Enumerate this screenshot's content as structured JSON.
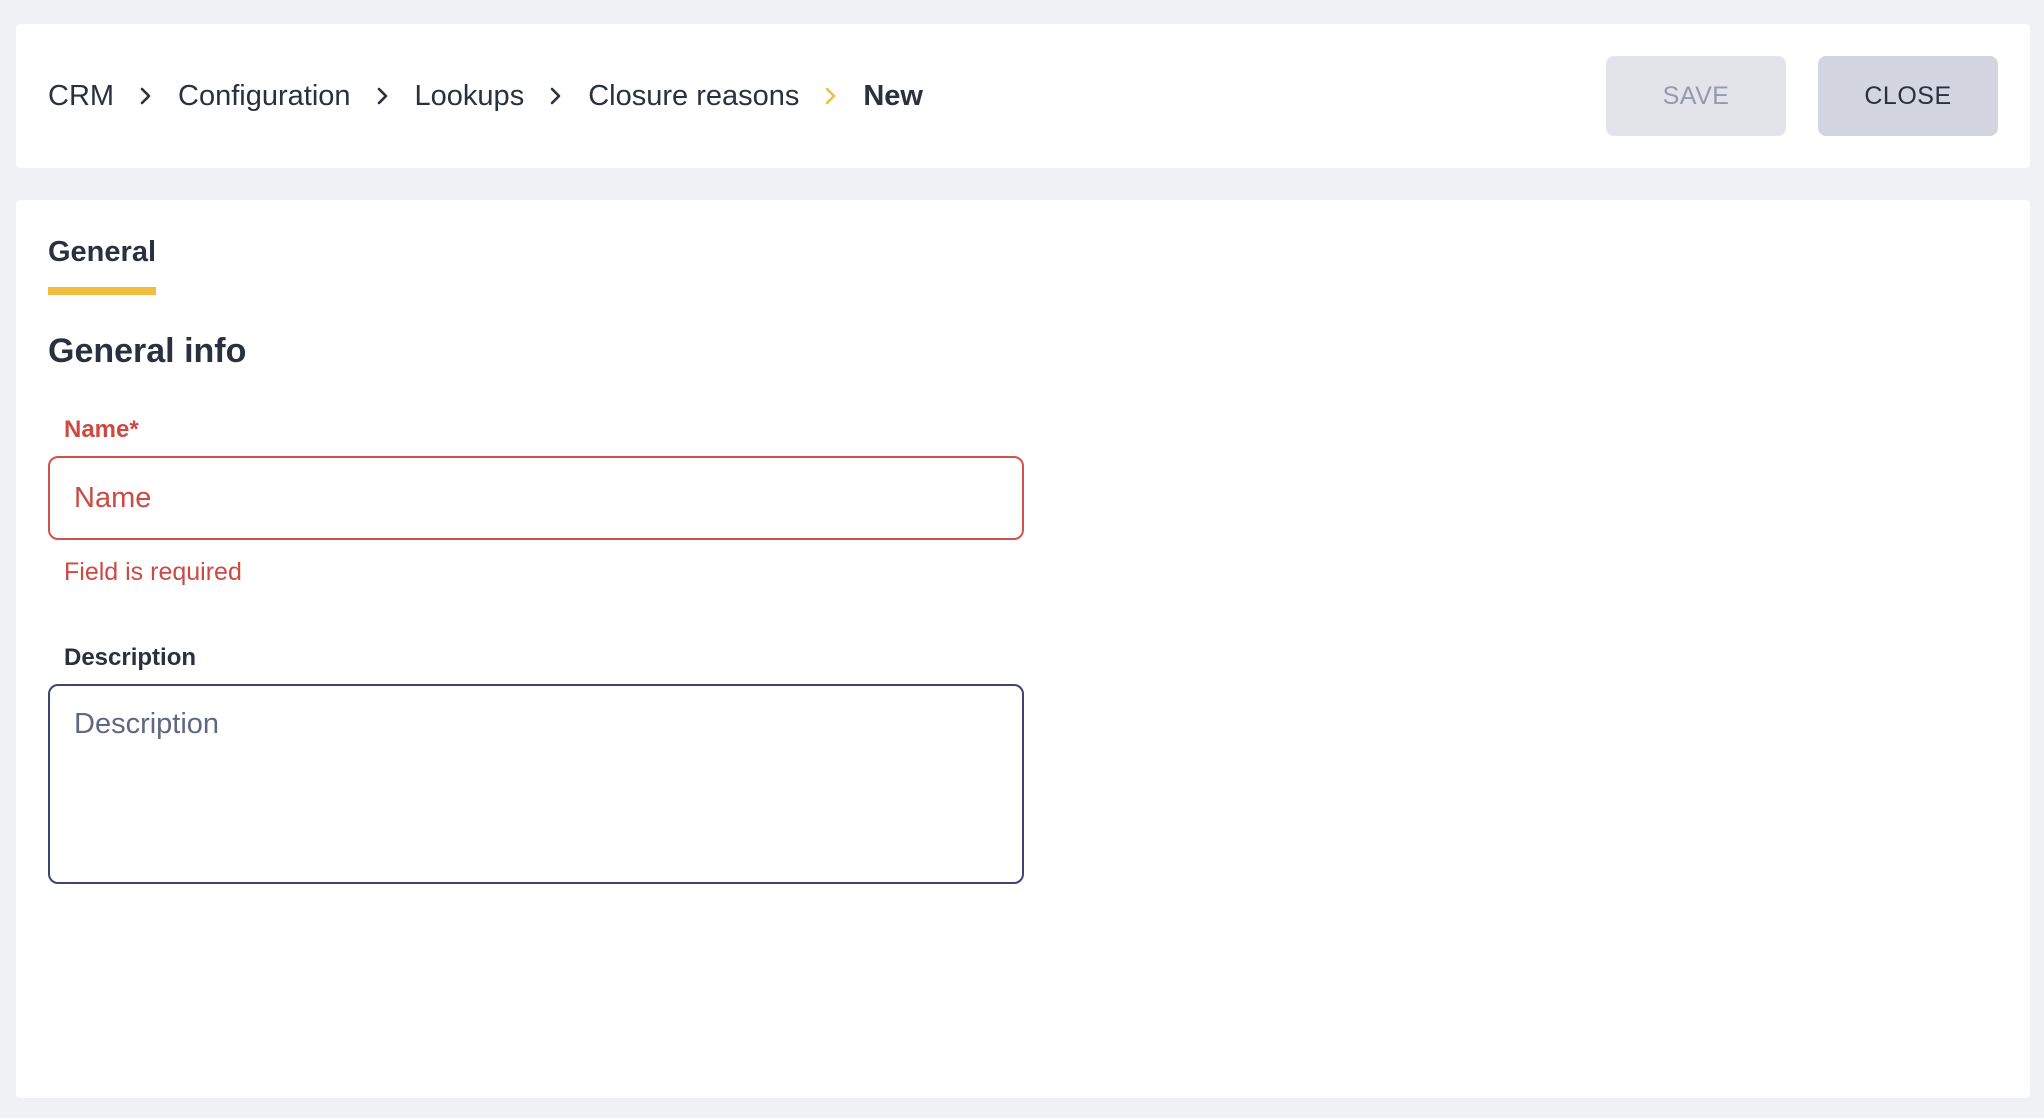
{
  "breadcrumb": {
    "items": [
      "CRM",
      "Configuration",
      "Lookups",
      "Closure reasons"
    ],
    "current": "New"
  },
  "toolbar": {
    "save_label": "SAVE",
    "close_label": "CLOSE"
  },
  "tabs": [
    {
      "label": "General",
      "active": true
    }
  ],
  "section": {
    "title": "General info"
  },
  "form": {
    "name": {
      "label": "Name*",
      "placeholder": "Name",
      "value": "",
      "error": "Field is required"
    },
    "description": {
      "label": "Description",
      "placeholder": "Description",
      "value": ""
    }
  },
  "colors": {
    "accent": "#f0bd3f",
    "error": "#cc4a43",
    "text": "#2b3040",
    "input_border": "#3c4576",
    "save_bg": "#e2e4ea",
    "close_bg": "#d3d6e1"
  },
  "icons": {
    "separator": "chevron-right-icon"
  }
}
